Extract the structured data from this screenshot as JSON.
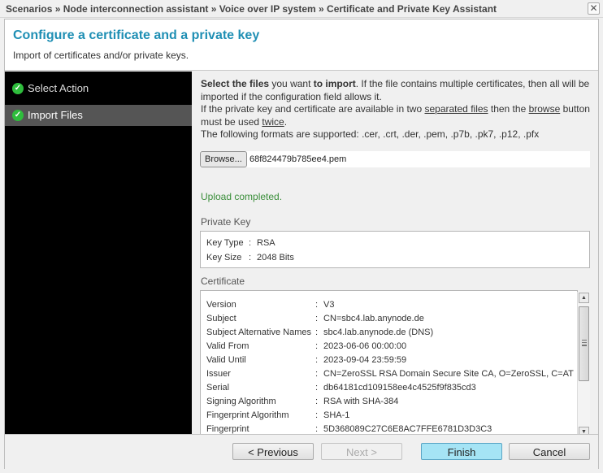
{
  "window": {
    "breadcrumb": "Scenarios » Node interconnection assistant » Voice over IP system » Certificate and Private Key Assistant",
    "close_icon": "close-icon"
  },
  "header": {
    "title": "Configure a certificate and a private key",
    "subtitle": "Import of certificates and/or private keys."
  },
  "steps": [
    {
      "label": "Select Action",
      "icon": "check-circle-icon",
      "active": false
    },
    {
      "label": "Import Files",
      "icon": "check-circle-icon",
      "active": true
    }
  ],
  "intro": {
    "p1_bold1": "Select the files",
    "p1_text1": " you want ",
    "p1_bold2": "to import",
    "p1_text2": ". If the file contains multiple certificates, then all will be imported if the configuration field allows it.",
    "p2_text1": "If the private key and certificate are available in two ",
    "p2_u1": "separated files",
    "p2_text2": " then the ",
    "p2_u2": "browse",
    "p2_text3": " button must be used ",
    "p2_u3": "twice",
    "p2_text4": ".",
    "p3": "The following formats are supported: .cer, .crt, .der, .pem, .p7b, .pk7, .p12, .pfx"
  },
  "file": {
    "browse_label": "Browse...",
    "filename": "68f824479b785ee4.pem",
    "status": "Upload completed."
  },
  "private_key": {
    "title": "Private Key",
    "rows": [
      {
        "key": "Key Type",
        "value": "RSA"
      },
      {
        "key": "Key Size",
        "value": "2048 Bits"
      }
    ]
  },
  "certificate": {
    "title": "Certificate",
    "rows": [
      {
        "key": "Version",
        "value": "V3"
      },
      {
        "key": "Subject",
        "value": "CN=sbc4.lab.anynode.de"
      },
      {
        "key": "Subject Alternative Names",
        "value": "sbc4.lab.anynode.de (DNS)"
      },
      {
        "key": "Valid From",
        "value": "2023-06-06 00:00:00"
      },
      {
        "key": "Valid Until",
        "value": "2023-09-04 23:59:59"
      },
      {
        "key": "Issuer",
        "value": "CN=ZeroSSL RSA Domain Secure Site CA, O=ZeroSSL, C=AT"
      },
      {
        "key": "Serial",
        "value": "db64181cd109158ee4c4525f9f835cd3"
      },
      {
        "key": "Signing Algorithm",
        "value": "RSA with SHA-384"
      },
      {
        "key": "Fingerprint Algorithm",
        "value": "SHA-1"
      },
      {
        "key": "Fingerprint",
        "value": "5D368089C27C6E8AC7FFE6781D3D3C3"
      }
    ],
    "separator": ":"
  },
  "footer": {
    "previous": "< Previous",
    "next": "Next >",
    "finish": "Finish",
    "cancel": "Cancel"
  },
  "colors": {
    "title": "#1f8fb4",
    "status_ok": "#3a8e3a",
    "primary_button": "#a5e4f5",
    "check": "#2ebd3c"
  }
}
